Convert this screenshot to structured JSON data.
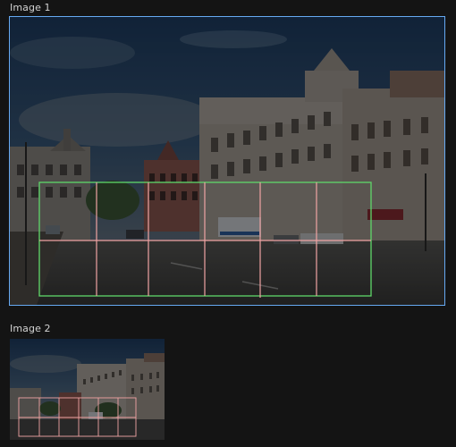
{
  "images": [
    {
      "label": "Image 1",
      "selected": true
    },
    {
      "label": "Image 2",
      "selected": false
    }
  ],
  "colors": {
    "background": "#141414",
    "label_text": "#d2d2d2",
    "selection_border": "#66a9f2",
    "outer_grid": "#5fd86a",
    "inner_grid": "#f0a3a3",
    "dim_overlay": "rgba(0,0,0,0.45)"
  },
  "scene": {
    "description_icon": "street-photo"
  }
}
